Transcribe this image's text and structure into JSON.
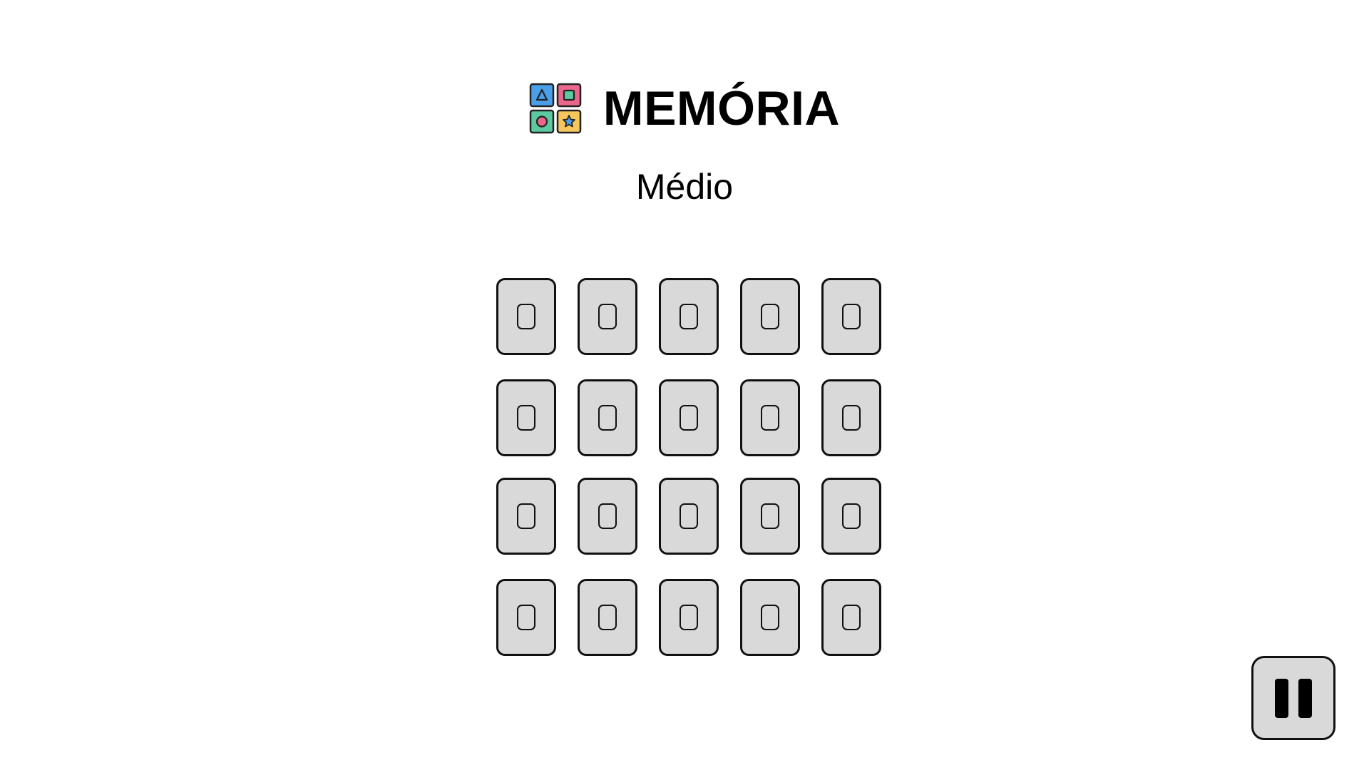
{
  "header": {
    "title": "MEMÓRIA",
    "logo_icon": "memory-game-logo-icon",
    "logo_colors": {
      "blue": "#4a9fe8",
      "pink": "#e8678a",
      "green": "#5cc9a0",
      "yellow": "#f6c55c",
      "outline": "#222222"
    }
  },
  "difficulty": "Médio",
  "board": {
    "rows": 4,
    "columns": 5,
    "card_state": "face-down",
    "card_back_color": "#d9d9d9",
    "card_border_color": "#111111"
  },
  "controls": {
    "pause_icon": "pause-icon"
  }
}
